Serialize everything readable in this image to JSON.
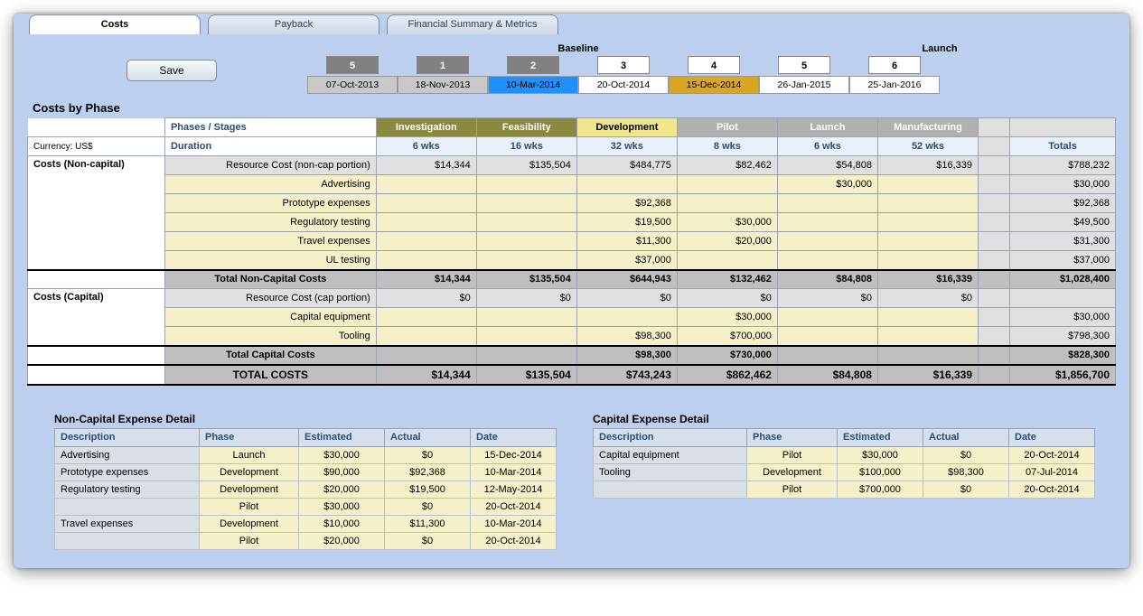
{
  "tabs": {
    "t0": "Costs",
    "t1": "Payback",
    "t2": "Financial Summary & Metrics"
  },
  "btn": {
    "save": "Save"
  },
  "hdr": {
    "baseline": "Baseline",
    "launch": "Launch"
  },
  "gates": {
    "g0": "5",
    "g1": "1",
    "g2": "2",
    "g3": "3",
    "g4": "4",
    "g5": "5",
    "g6": "6"
  },
  "dates": {
    "d0": "07-Oct-2013",
    "d1": "18-Nov-2013",
    "d2": "10-Mar-2014",
    "d3": "20-Oct-2014",
    "d4": "15-Dec-2014",
    "d5": "26-Jan-2015",
    "d6": "25-Jan-2016"
  },
  "sec": {
    "cbp": "Costs by Phase",
    "phst": "Phases / Stages",
    "cur": "Currency: US$",
    "dur": "Duration",
    "cnc": "Costs (Non-capital)",
    "cc": "Costs (Capital)",
    "tot_nc": "Total Non-Capital Costs",
    "tot_c": "Total Capital Costs",
    "tot": "TOTAL COSTS",
    "totals": "Totals"
  },
  "ph": {
    "p0": "Investigation",
    "p1": "Feasibility",
    "p2": "Development",
    "p3": "Pilot",
    "p4": "Launch",
    "p5": "Manufacturing"
  },
  "du": {
    "u0": "6 wks",
    "u1": "16 wks",
    "u2": "32 wks",
    "u3": "8 wks",
    "u4": "6 wks",
    "u5": "52 wks"
  },
  "nc": {
    "r0": {
      "lab": "Resource Cost (non-cap portion)",
      "c0": "$14,344",
      "c1": "$135,504",
      "c2": "$484,775",
      "c3": "$82,462",
      "c4": "$54,808",
      "c5": "$16,339",
      "tot": "$788,232"
    },
    "r1": {
      "lab": "Advertising",
      "c4": "$30,000",
      "tot": "$30,000"
    },
    "r2": {
      "lab": "Prototype expenses",
      "c2": "$92,368",
      "tot": "$92,368"
    },
    "r3": {
      "lab": "Regulatory testing",
      "c2": "$19,500",
      "c3": "$30,000",
      "tot": "$49,500"
    },
    "r4": {
      "lab": "Travel expenses",
      "c2": "$11,300",
      "c3": "$20,000",
      "tot": "$31,300"
    },
    "r5": {
      "lab": "UL testing",
      "c2": "$37,000",
      "tot": "$37,000"
    },
    "tot": {
      "c0": "$14,344",
      "c1": "$135,504",
      "c2": "$644,943",
      "c3": "$132,462",
      "c4": "$84,808",
      "c5": "$16,339",
      "tot": "$1,028,400"
    }
  },
  "cap": {
    "r0": {
      "lab": "Resource Cost (cap portion)",
      "c0": "$0",
      "c1": "$0",
      "c2": "$0",
      "c3": "$0",
      "c4": "$0",
      "c5": "$0"
    },
    "r1": {
      "lab": "Capital equipment",
      "c3": "$30,000",
      "tot": "$30,000"
    },
    "r2": {
      "lab": "Tooling",
      "c2": "$98,300",
      "c3": "$700,000",
      "tot": "$798,300"
    },
    "tot": {
      "c2": "$98,300",
      "c3": "$730,000",
      "tot": "$828,300"
    }
  },
  "grand": {
    "c0": "$14,344",
    "c1": "$135,504",
    "c2": "$743,243",
    "c3": "$862,462",
    "c4": "$84,808",
    "c5": "$16,339",
    "tot": "$1,856,700"
  },
  "det": {
    "nctitle": "Non-Capital Expense Detail",
    "captitle": "Capital Expense Detail",
    "h": {
      "desc": "Description",
      "phase": "Phase",
      "est": "Estimated",
      "act": "Actual",
      "date": "Date"
    },
    "nc0": {
      "desc": "Advertising",
      "ph": "Launch",
      "est": "$30,000",
      "act": "$0",
      "date": "15-Dec-2014"
    },
    "nc1": {
      "desc": "Prototype expenses",
      "ph": "Development",
      "est": "$90,000",
      "act": "$92,368",
      "date": "10-Mar-2014"
    },
    "nc2": {
      "desc": "Regulatory testing",
      "ph": "Development",
      "est": "$20,000",
      "act": "$19,500",
      "date": "12-May-2014"
    },
    "nc3": {
      "desc": "",
      "ph": "Pilot",
      "est": "$30,000",
      "act": "$0",
      "date": "20-Oct-2014"
    },
    "nc4": {
      "desc": "Travel expenses",
      "ph": "Development",
      "est": "$10,000",
      "act": "$11,300",
      "date": "10-Mar-2014"
    },
    "nc5": {
      "desc": "",
      "ph": "Pilot",
      "est": "$20,000",
      "act": "$0",
      "date": "20-Oct-2014"
    },
    "cap0": {
      "desc": "Capital equipment",
      "ph": "Pilot",
      "est": "$30,000",
      "act": "$0",
      "date": "20-Oct-2014"
    },
    "cap1": {
      "desc": "Tooling",
      "ph": "Development",
      "est": "$100,000",
      "act": "$98,300",
      "date": "07-Jul-2014"
    },
    "cap2": {
      "desc": "",
      "ph": "Pilot",
      "est": "$700,000",
      "act": "$0",
      "date": "20-Oct-2014"
    }
  }
}
